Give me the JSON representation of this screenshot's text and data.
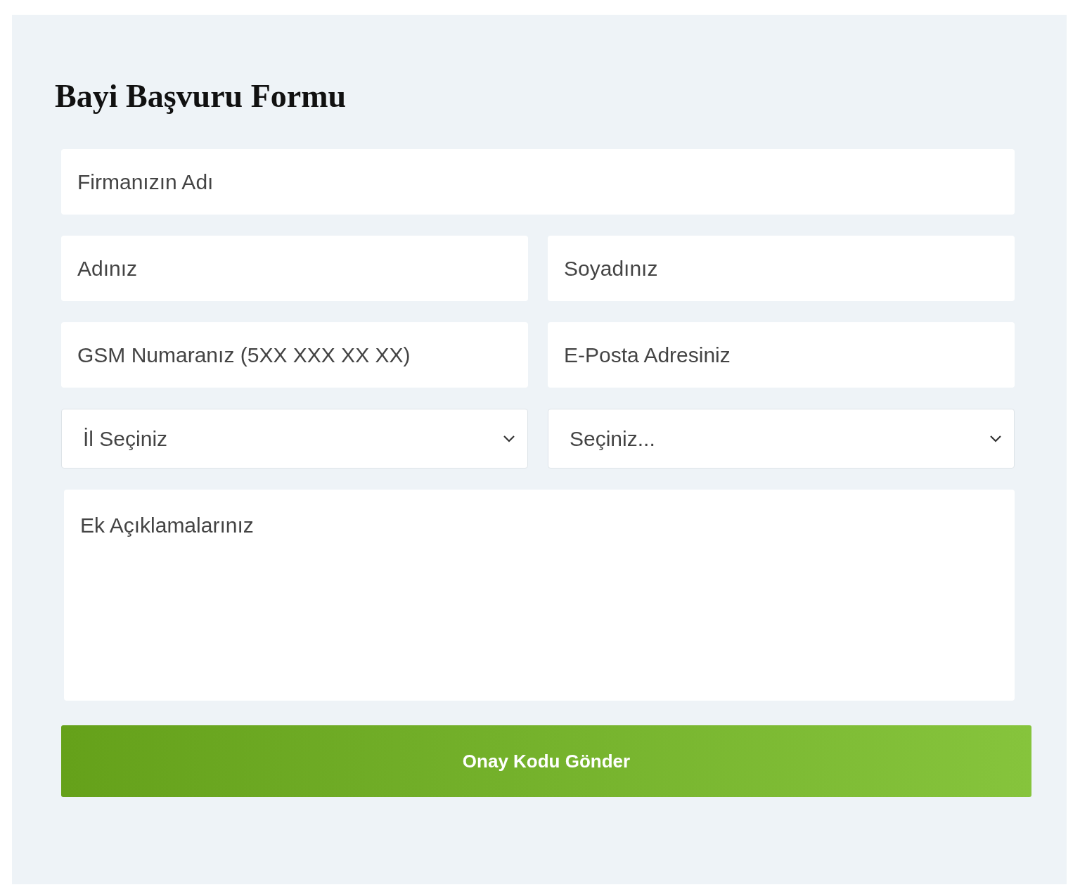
{
  "form": {
    "title": "Bayi Başvuru Formu",
    "rows": [
      [
        {
          "kind": "text",
          "placeholder": "Firmanızın Adı"
        }
      ],
      [
        {
          "kind": "text",
          "placeholder": "Adınız"
        },
        {
          "kind": "text",
          "placeholder": "Soyadınız"
        }
      ],
      [
        {
          "kind": "text",
          "placeholder": "GSM Numaranız (5XX XXX XX XX)"
        },
        {
          "kind": "text",
          "placeholder": "E-Posta Adresiniz"
        }
      ],
      [
        {
          "kind": "select",
          "value": "İl Seçiniz"
        },
        {
          "kind": "select",
          "value": "Seçiniz..."
        }
      ],
      [
        {
          "kind": "textarea",
          "placeholder": "Ek Açıklamalarınız"
        }
      ]
    ],
    "submit": "Onay Kodu Gönder"
  }
}
